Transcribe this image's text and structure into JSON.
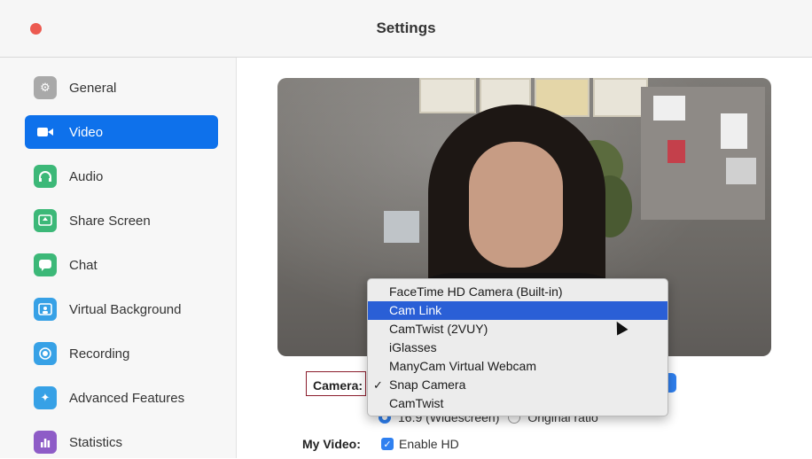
{
  "window": {
    "title": "Settings",
    "close_color": "#ec5a50"
  },
  "sidebar": {
    "items": [
      {
        "label": "General",
        "icon": "gear-icon",
        "color": "#a9a9a9",
        "active": false
      },
      {
        "label": "Video",
        "icon": "video-camera-icon",
        "color": "#0e71eb",
        "active": true
      },
      {
        "label": "Audio",
        "icon": "headphones-icon",
        "color": "#3cb878",
        "active": false
      },
      {
        "label": "Share Screen",
        "icon": "share-screen-icon",
        "color": "#3cb878",
        "active": false
      },
      {
        "label": "Chat",
        "icon": "chat-icon",
        "color": "#3cb878",
        "active": false
      },
      {
        "label": "Virtual Background",
        "icon": "person-background-icon",
        "color": "#37a1e6",
        "active": false
      },
      {
        "label": "Recording",
        "icon": "record-icon",
        "color": "#37a1e6",
        "active": false
      },
      {
        "label": "Advanced Features",
        "icon": "sparkle-icon",
        "color": "#37a1e6",
        "active": false
      },
      {
        "label": "Statistics",
        "icon": "bar-chart-icon",
        "color": "#8e5cc7",
        "active": false
      }
    ]
  },
  "video": {
    "camera_label": "Camera:",
    "camera_options": [
      {
        "label": "FaceTime HD Camera (Built-in)",
        "checked": false,
        "highlighted": false
      },
      {
        "label": "Cam Link",
        "checked": false,
        "highlighted": true
      },
      {
        "label": "CamTwist (2VUY)",
        "checked": false,
        "highlighted": false
      },
      {
        "label": "iGlasses",
        "checked": false,
        "highlighted": false
      },
      {
        "label": "ManyCam Virtual Webcam",
        "checked": false,
        "highlighted": false
      },
      {
        "label": "Snap Camera",
        "checked": true,
        "highlighted": false
      },
      {
        "label": "CamTwist",
        "checked": false,
        "highlighted": false
      }
    ],
    "check_mark": "✓",
    "ratio_widescreen": "16:9 (Widescreen)",
    "ratio_original": "Original ratio",
    "my_video_label": "My Video:",
    "enable_hd_label": "Enable HD",
    "enable_hd_checked": true,
    "accent": "#2f80f0"
  }
}
